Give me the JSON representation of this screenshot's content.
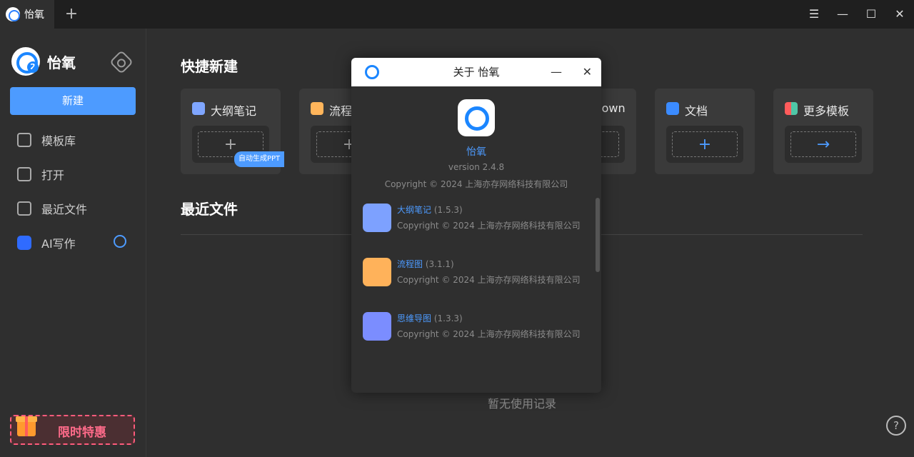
{
  "titlebar": {
    "tab_title": "怡氧",
    "new_tab": "+",
    "menu": "☰",
    "minimize": "—",
    "maximize": "☐",
    "close": "✕"
  },
  "sidebar": {
    "brand": "怡氧",
    "new_button": "新建",
    "items": [
      {
        "label": "模板库"
      },
      {
        "label": "打开"
      },
      {
        "label": "最近文件"
      },
      {
        "label": "AI写作"
      }
    ],
    "promo": "限时特惠"
  },
  "main": {
    "quick_title": "快捷新建",
    "cards": [
      {
        "label": "大纲笔记",
        "action": "+",
        "color": "#7fa6ff"
      },
      {
        "label": "流程图",
        "action": "+",
        "color": "#ffb55b"
      },
      {
        "label": "Markdown",
        "action": "+",
        "color": "#4fc6a7"
      },
      {
        "label": "文档",
        "action": "+",
        "color": "#3b8bff"
      },
      {
        "label": "更多模板",
        "action": "→",
        "color": "#ff8b5b"
      }
    ],
    "ppt_badge": "自动生成PPT",
    "recent_title": "最近文件",
    "empty_text": "暂无使用记录",
    "help": "?"
  },
  "dialog": {
    "title": "关于 怡氧",
    "min": "—",
    "close": "✕",
    "app_name": "怡氧",
    "version": "version 2.4.8",
    "copyright": "Copyright © 2024 上海亦存网络科技有限公司",
    "subapps": [
      {
        "name": "大纲笔记",
        "ver": "(1.5.3)",
        "copy": "Copyright © 2024 上海亦存网络科技有限公司",
        "color": "#7da1ff"
      },
      {
        "name": "流程图",
        "ver": "(3.1.1)",
        "copy": "Copyright © 2024 上海亦存网络科技有限公司",
        "color": "#ffb25a"
      },
      {
        "name": "思维导图",
        "ver": "(1.3.3)",
        "copy": "Copyright © 2024 上海亦存网络科技有限公司",
        "color": "#7b8dff"
      }
    ]
  }
}
